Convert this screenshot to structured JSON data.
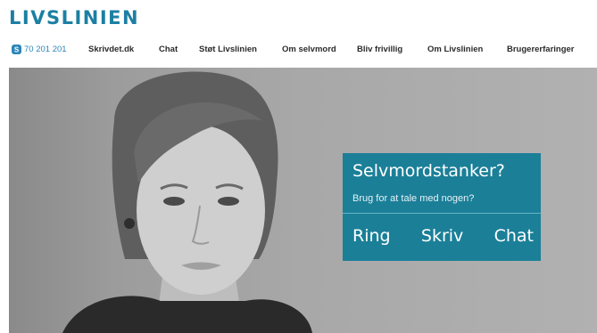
{
  "brand": {
    "logo_text": "LIVSLINIEN",
    "accent": "#1c7fa3"
  },
  "nav": {
    "phone": {
      "icon": "skype-phone-icon",
      "number": "70 201 201"
    },
    "items": [
      {
        "label": "Skrivdet.dk"
      },
      {
        "label": "Chat"
      },
      {
        "label": "Støt Livslinien"
      },
      {
        "label": "Om selvmord"
      },
      {
        "label": "Bliv frivillig"
      },
      {
        "label": "Om Livslinien"
      },
      {
        "label": "Brugererfaringer"
      }
    ]
  },
  "hero": {
    "cta": {
      "headline": "Selvmordstanker?",
      "subtitle": "Brug for at tale med nogen?",
      "links": [
        {
          "label": "Ring"
        },
        {
          "label": "Skriv"
        },
        {
          "label": "Chat"
        }
      ],
      "background": "#1b7f98"
    }
  }
}
